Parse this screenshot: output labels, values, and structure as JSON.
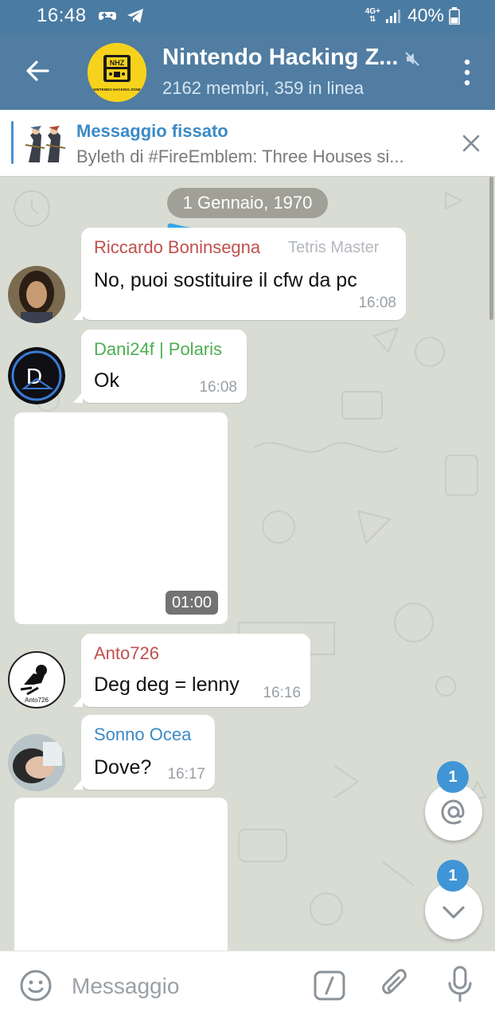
{
  "status_bar": {
    "time": "16:48",
    "network": "4G+",
    "battery": "40%"
  },
  "header": {
    "title": "Nintendo Hacking Z...",
    "subtitle": "2162 membri, 359 in linea",
    "logo_text": "NHZ",
    "logo_caption": "NINTENDO HACKING ZONE"
  },
  "pinned": {
    "title": "Messaggio fissato",
    "text": "Byleth di #FireEmblem: Three Houses si..."
  },
  "date_separator": "1 Gennaio, 1970",
  "messages": [
    {
      "sender": "Riccardo Boninsegna",
      "sender_color": "#c0504d",
      "title": "Tetris Master",
      "text": "No, puoi sostituire il cfw da pc",
      "time": "16:08"
    },
    {
      "sender": "Dani24f | Polaris",
      "sender_color": "#4caf50",
      "text": "Ok",
      "time": "16:08"
    },
    {
      "media_duration": "01:00"
    },
    {
      "sender": "Anto726",
      "sender_color": "#c0504d",
      "text": "Deg deg = lenny",
      "time": "16:16",
      "avatar_text": "Anto726"
    },
    {
      "sender": "Sonno Ocea",
      "sender_color": "#3c8ac6",
      "text": "Dove?",
      "time": "16:17"
    }
  ],
  "fabs": {
    "mentions_count": "1",
    "scroll_down_count": "1"
  },
  "input": {
    "placeholder": "Messaggio"
  },
  "colors": {
    "header_bg": "#517da2",
    "accent": "#4095d6",
    "chat_bg": "#d9dcd3"
  }
}
